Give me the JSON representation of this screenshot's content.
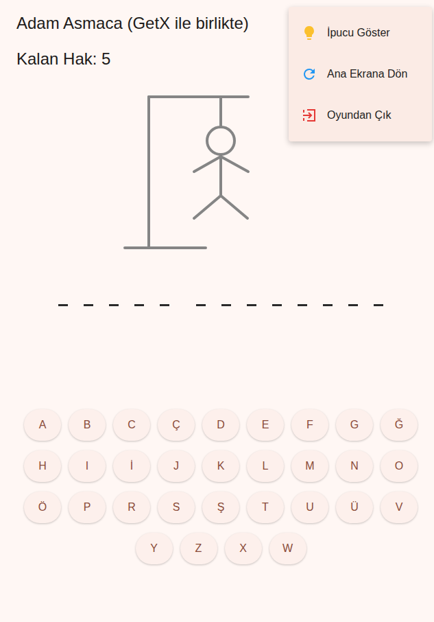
{
  "title": "Adam Asmaca (GetX ile birlikte)",
  "remaining": "Kalan Hak: 5",
  "hangman": {
    "parts": [
      {
        "kind": "head",
        "shown": true
      },
      {
        "kind": "body",
        "shown": true
      },
      {
        "kind": "left-arm",
        "shown": true
      },
      {
        "kind": "right-arm",
        "shown": true
      },
      {
        "kind": "left-leg",
        "shown": true
      },
      {
        "kind": "right-leg",
        "shown": true
      }
    ]
  },
  "word": [
    {
      "slots": [
        {
          "char": "",
          "revealed": false
        },
        {
          "char": "",
          "revealed": false
        },
        {
          "char": "",
          "revealed": false
        },
        {
          "char": "",
          "revealed": false
        },
        {
          "char": "",
          "revealed": false
        }
      ]
    },
    {
      "slots": [
        {
          "char": "",
          "revealed": false
        },
        {
          "char": "",
          "revealed": false
        },
        {
          "char": "",
          "revealed": false
        },
        {
          "char": "",
          "revealed": false
        },
        {
          "char": "",
          "revealed": false
        },
        {
          "char": "",
          "revealed": false
        },
        {
          "char": "",
          "revealed": false
        },
        {
          "char": "",
          "revealed": false
        }
      ]
    }
  ],
  "keyboard": [
    [
      {
        "label": "A",
        "disabled": false
      },
      {
        "label": "B",
        "disabled": false
      },
      {
        "label": "C",
        "disabled": false
      },
      {
        "label": "Ç",
        "disabled": false
      },
      {
        "label": "D",
        "disabled": false
      },
      {
        "label": "E",
        "disabled": false
      },
      {
        "label": "F",
        "disabled": false
      },
      {
        "label": "G",
        "disabled": false
      },
      {
        "label": "Ğ",
        "disabled": false
      }
    ],
    [
      {
        "label": "H",
        "disabled": false
      },
      {
        "label": "I",
        "disabled": false
      },
      {
        "label": "İ",
        "disabled": false
      },
      {
        "label": "J",
        "disabled": false
      },
      {
        "label": "K",
        "disabled": false
      },
      {
        "label": "L",
        "disabled": false
      },
      {
        "label": "M",
        "disabled": false
      },
      {
        "label": "N",
        "disabled": false
      },
      {
        "label": "O",
        "disabled": false
      }
    ],
    [
      {
        "label": "Ö",
        "disabled": false
      },
      {
        "label": "P",
        "disabled": false
      },
      {
        "label": "R",
        "disabled": false
      },
      {
        "label": "S",
        "disabled": false
      },
      {
        "label": "Ş",
        "disabled": false
      },
      {
        "label": "T",
        "disabled": false
      },
      {
        "label": "U",
        "disabled": false
      },
      {
        "label": "Ü",
        "disabled": false
      },
      {
        "label": "V",
        "disabled": false
      }
    ],
    [
      {
        "label": "Y",
        "disabled": false
      },
      {
        "label": "Z",
        "disabled": false
      },
      {
        "label": "X",
        "disabled": false
      },
      {
        "label": "W",
        "disabled": false
      }
    ]
  ],
  "menu": {
    "open": true,
    "items": [
      {
        "label": "İpucu Göster",
        "kind": "hint"
      },
      {
        "label": "Ana Ekrana Dön",
        "kind": "restart"
      },
      {
        "label": "Oyundan Çık",
        "kind": "exit"
      }
    ]
  }
}
